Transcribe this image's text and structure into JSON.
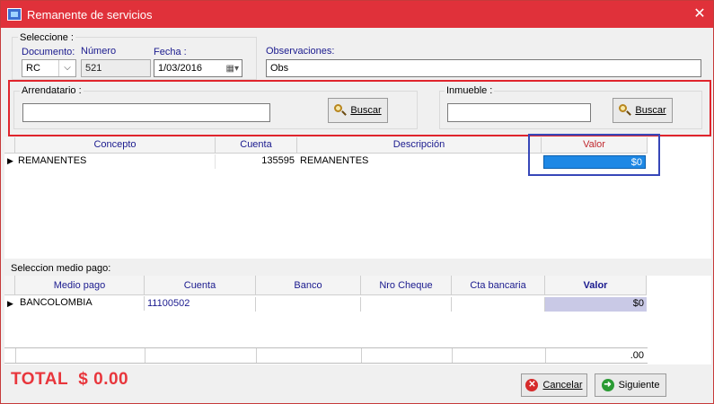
{
  "window": {
    "title": "Remanente de servicios",
    "close_glyph": "✕"
  },
  "seleccione": {
    "group_title": "Seleccione :",
    "documento_label": "Documento:",
    "documento_value": "RC",
    "numero_label": "Número",
    "numero_value": "521",
    "fecha_label": "Fecha :",
    "fecha_value": "1/03/2016"
  },
  "observaciones": {
    "label": "Observaciones:",
    "value": "Obs"
  },
  "arrendatario": {
    "label": "Arrendatario :",
    "value": "",
    "button": "Buscar"
  },
  "inmueble": {
    "label": "Inmueble :",
    "value": "",
    "button": "Buscar"
  },
  "concepto_grid": {
    "headers": {
      "concepto": "Concepto",
      "cuenta": "Cuenta",
      "descripcion": "Descripción",
      "valor": "Valor"
    },
    "rows": [
      {
        "concepto": "REMANENTES",
        "cuenta": "135595",
        "descripcion": "REMANENTES",
        "valor": "$0"
      }
    ]
  },
  "medio_pago": {
    "label": "Seleccion medio pago:",
    "headers": {
      "medio": "Medio pago",
      "cuenta": "Cuenta",
      "banco": "Banco",
      "cheque": "Nro Cheque",
      "cta": "Cta bancaria",
      "valor": "Valor"
    },
    "rows": [
      {
        "medio": "BANCOLOMBIA",
        "cuenta": "11100502",
        "banco": "",
        "cheque": "",
        "cta": "",
        "valor": "$0"
      }
    ],
    "footer_total": ".00"
  },
  "total": "TOTAL  $ 0.00",
  "buttons": {
    "cancelar": "Cancelar",
    "siguiente": "Siguiente"
  },
  "icons": {
    "app": "app-icon",
    "close": "close-icon",
    "search": "magnifier-icon",
    "cancel": "cancel-icon",
    "next": "next-arrow-icon",
    "calendar": "calendar-icon"
  },
  "colors": {
    "titlebar": "#e0313a",
    "total": "#e8363c",
    "header_text": "#1a1a8e",
    "selected_value": "#1e88e5"
  }
}
